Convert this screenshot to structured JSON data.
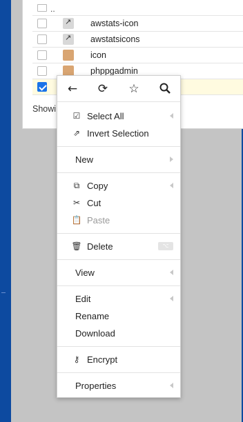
{
  "files": {
    "updir_label": "..",
    "rows": [
      {
        "name": "awstats-icon",
        "type": "link",
        "checked": false
      },
      {
        "name": "awstatsicons",
        "type": "link",
        "checked": false
      },
      {
        "name": "icon",
        "type": "folder",
        "checked": false
      },
      {
        "name": "phppgadmin",
        "type": "folder",
        "checked": false
      },
      {
        "name": "",
        "type": "folder",
        "checked": true
      }
    ],
    "showing_text": "Showi"
  },
  "context_menu": {
    "toolbar": [
      {
        "icon": "back-arrow-icon",
        "glyph": "←"
      },
      {
        "icon": "refresh-icon",
        "glyph": "⟳"
      },
      {
        "icon": "star-icon",
        "glyph": "☆"
      },
      {
        "icon": "search-icon",
        "glyph": "🔍"
      }
    ],
    "items": {
      "select_all": "Select All",
      "invert_selection": "Invert Selection",
      "new": "New",
      "copy": "Copy",
      "cut": "Cut",
      "paste": "Paste",
      "delete": "Delete",
      "view": "View",
      "edit": "Edit",
      "rename": "Rename",
      "download": "Download",
      "encrypt": "Encrypt",
      "properties": "Properties"
    },
    "delete_shortcut": "⌥"
  },
  "colors": {
    "accent": "#1a73e8",
    "window_frame": "#0d4aa0",
    "backdrop": "#c4c4c4",
    "folder": "#d9a572",
    "selected_row": "#fffbe0"
  }
}
